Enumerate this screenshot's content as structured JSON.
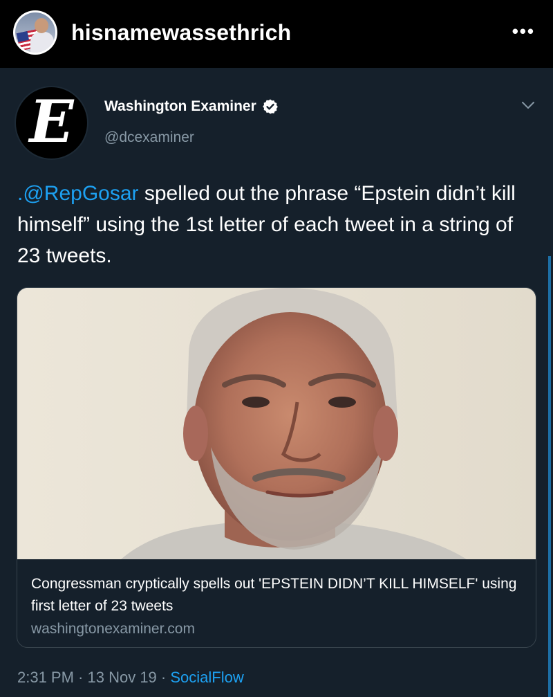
{
  "instagram": {
    "username": "hisnamewassethrich",
    "more_icon": "ellipsis-icon"
  },
  "tweet": {
    "author": {
      "name": "Washington Examiner",
      "handle": "@dcexaminer",
      "verified": true,
      "logo_letter": "E"
    },
    "text": {
      "mention": ".@RepGosar",
      "body": " spelled out the phrase “Epstein didn’t kill himself” using the 1st letter of each tweet in a string of 23 tweets."
    },
    "card": {
      "title": "Congressman cryptically spells out 'EPSTEIN DIDN’T KILL HIMSELF' using first letter of 23 tweets",
      "domain": "washingtonexaminer.com"
    },
    "meta": {
      "time": "2:31 PM",
      "separator": " · ",
      "date": "13 Nov 19",
      "source": "SocialFlow"
    }
  },
  "colors": {
    "background": "#15202b",
    "accent": "#1da1f2",
    "secondary_text": "#8899a6",
    "border": "#38444d"
  }
}
